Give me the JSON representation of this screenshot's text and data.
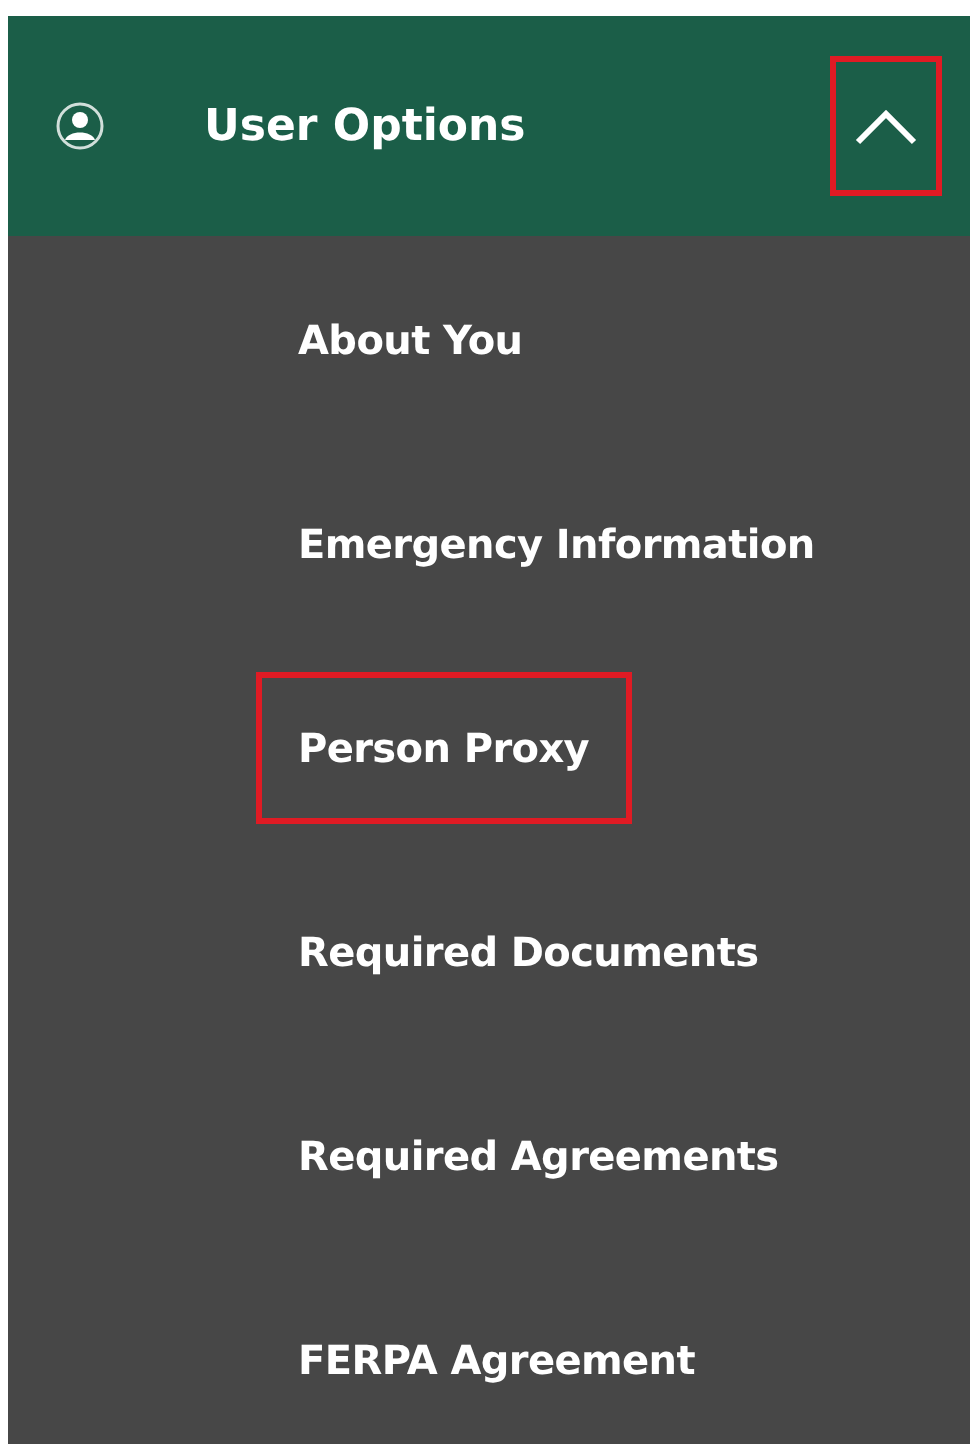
{
  "menu": {
    "title": "User Options",
    "expanded": true,
    "toggle_highlighted": true,
    "items": [
      {
        "label": "About You",
        "highlighted": false
      },
      {
        "label": "Emergency Information",
        "highlighted": false
      },
      {
        "label": "Person Proxy",
        "highlighted": true
      },
      {
        "label": "Required Documents",
        "highlighted": false
      },
      {
        "label": "Required Agreements",
        "highlighted": false
      },
      {
        "label": "FERPA Agreement",
        "highlighted": false
      }
    ]
  }
}
